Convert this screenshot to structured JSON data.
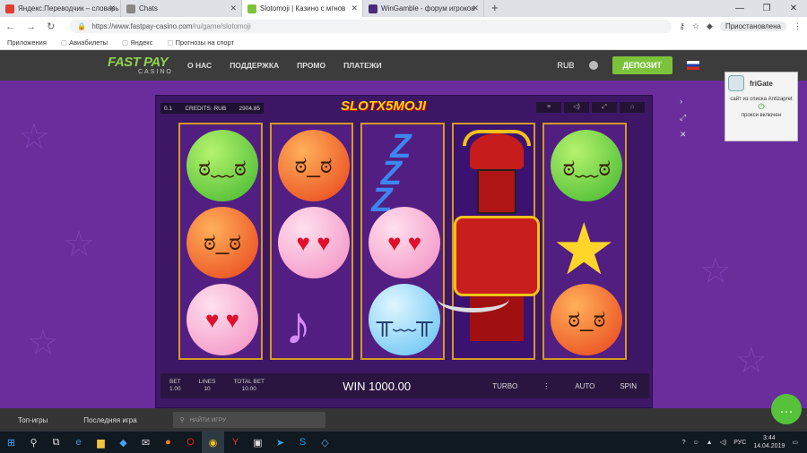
{
  "browser": {
    "tabs": [
      {
        "label": "Яндекс.Переводчик – словарь",
        "favcolor": "#e23d30",
        "active": false
      },
      {
        "label": "Chats",
        "favcolor": "#888888",
        "active": false
      },
      {
        "label": "Slotomoji | Казино с мгнов",
        "favcolor": "#7cc33a",
        "active": true
      },
      {
        "label": "WinGamble - форум игроков",
        "favcolor": "#4a2a7a",
        "active": false
      }
    ],
    "new_tab": "+",
    "url_host": "https://www.fastpay-casino.com",
    "url_path": "/ru/game/slotomoji",
    "profile_label": "Приостановлена",
    "bookmarks": [
      "Приложения",
      "Авиабилеты",
      "Яндекс",
      "Прогнозы на спорт"
    ]
  },
  "site": {
    "logo_top": "FAST PAY",
    "logo_bottom": "CASINO",
    "menu": [
      "О НАС",
      "ПОДДЕРЖКА",
      "ПРОМО",
      "ПЛАТЕЖИ"
    ],
    "currency": "RUB",
    "deposit": "ДЕПОЗИТ"
  },
  "game": {
    "bet_value": "0.1",
    "credits_label": "CREDITS: RUB",
    "credits_value": "2904.85",
    "title": "SLOTX5MOJI",
    "bet_label": "BET",
    "bet": "1.00",
    "lines_label": "LINES",
    "lines": "10",
    "total_bet_label": "TOTAL BET",
    "total_bet": "10.00",
    "win_text": "WIN 1000.00",
    "turbo": "TURBO",
    "auto": "AUTO",
    "spin": "SPIN"
  },
  "frigate": {
    "title": "friGate",
    "line1": "сайт из списка Antizapret",
    "line2": "прокси включен"
  },
  "footer": {
    "top_games": "Топ-игры",
    "last_game": "Последняя игра",
    "search_placeholder": "НАЙТИ ИГРУ"
  },
  "taskbar": {
    "lang": "РУС",
    "time": "3:44",
    "date": "14.04.2019"
  }
}
